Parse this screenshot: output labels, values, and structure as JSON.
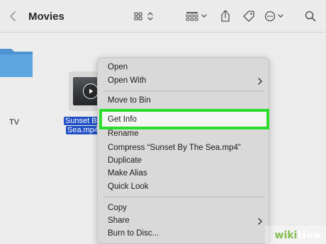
{
  "window": {
    "title": "Movies"
  },
  "toolbar": {
    "icons": [
      "chevron-left-icon",
      "grid-view-icon",
      "group-view-icon",
      "share-icon",
      "tag-icon",
      "ellipsis-icon",
      "search-icon"
    ]
  },
  "files": [
    {
      "name": "TV",
      "kind": "folder",
      "selected": false
    },
    {
      "name_line1": "Sunset By",
      "name_line2": "Sea.mp4",
      "kind": "video",
      "selected": true
    }
  ],
  "context_menu": {
    "items": [
      {
        "label": "Open",
        "has_submenu": false
      },
      {
        "label": "Open With",
        "has_submenu": true
      },
      {
        "label": "Move to Bin",
        "has_submenu": false
      },
      {
        "label": "Get Info",
        "has_submenu": false,
        "highlighted": true
      },
      {
        "label": "Rename",
        "has_submenu": false
      },
      {
        "label": "Compress “Sunset By The Sea.mp4”",
        "has_submenu": false
      },
      {
        "label": "Duplicate",
        "has_submenu": false
      },
      {
        "label": "Make Alias",
        "has_submenu": false
      },
      {
        "label": "Quick Look",
        "has_submenu": false
      },
      {
        "label": "Copy",
        "has_submenu": false
      },
      {
        "label": "Share",
        "has_submenu": true
      },
      {
        "label": "Burn to Disc...",
        "has_submenu": false
      }
    ]
  },
  "colors": {
    "highlight_border": "#2bde2b",
    "selection": "#1f4fc4",
    "folder": "#5a9fd8"
  },
  "watermark": {
    "part1": "wiki",
    "part2": "How"
  }
}
